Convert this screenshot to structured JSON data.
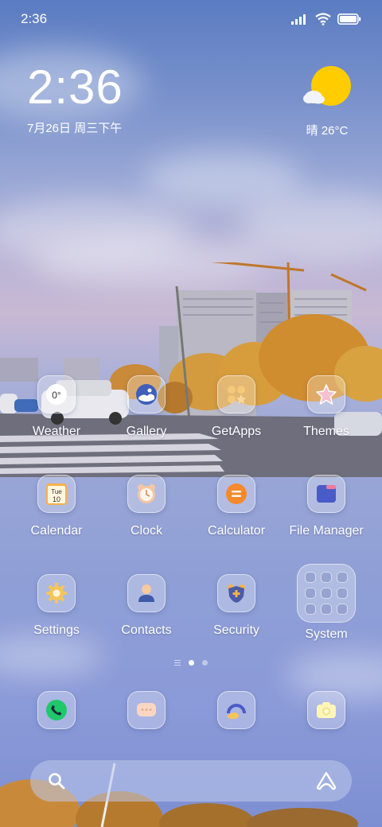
{
  "status_bar": {
    "time": "2:36"
  },
  "clock_widget": {
    "time": "2:36",
    "date": "7月26日 周三下午"
  },
  "weather_widget": {
    "text": "晴 26°C"
  },
  "weather_app_icon_text": "0°",
  "calendar_icon": {
    "day": "Tue",
    "date": "10"
  },
  "apps_row1": [
    {
      "label": "Weather"
    },
    {
      "label": "Gallery"
    },
    {
      "label": "GetApps"
    },
    {
      "label": "Themes"
    }
  ],
  "apps_row2": [
    {
      "label": "Calendar"
    },
    {
      "label": "Clock"
    },
    {
      "label": "Calculator"
    },
    {
      "label": "File Manager"
    }
  ],
  "apps_row3": [
    {
      "label": "Settings"
    },
    {
      "label": "Contacts"
    },
    {
      "label": "Security"
    },
    {
      "label": "System"
    }
  ],
  "page_indicator": {
    "pages": 2,
    "active": 1
  },
  "dock": [
    "phone-icon",
    "messages-icon",
    "browser-icon",
    "camera-icon"
  ],
  "colors": {
    "sun": "#FFCC00",
    "phone": "#1FC86A",
    "calculator": "#F5892E",
    "file_manager": "#4A5BC8"
  }
}
